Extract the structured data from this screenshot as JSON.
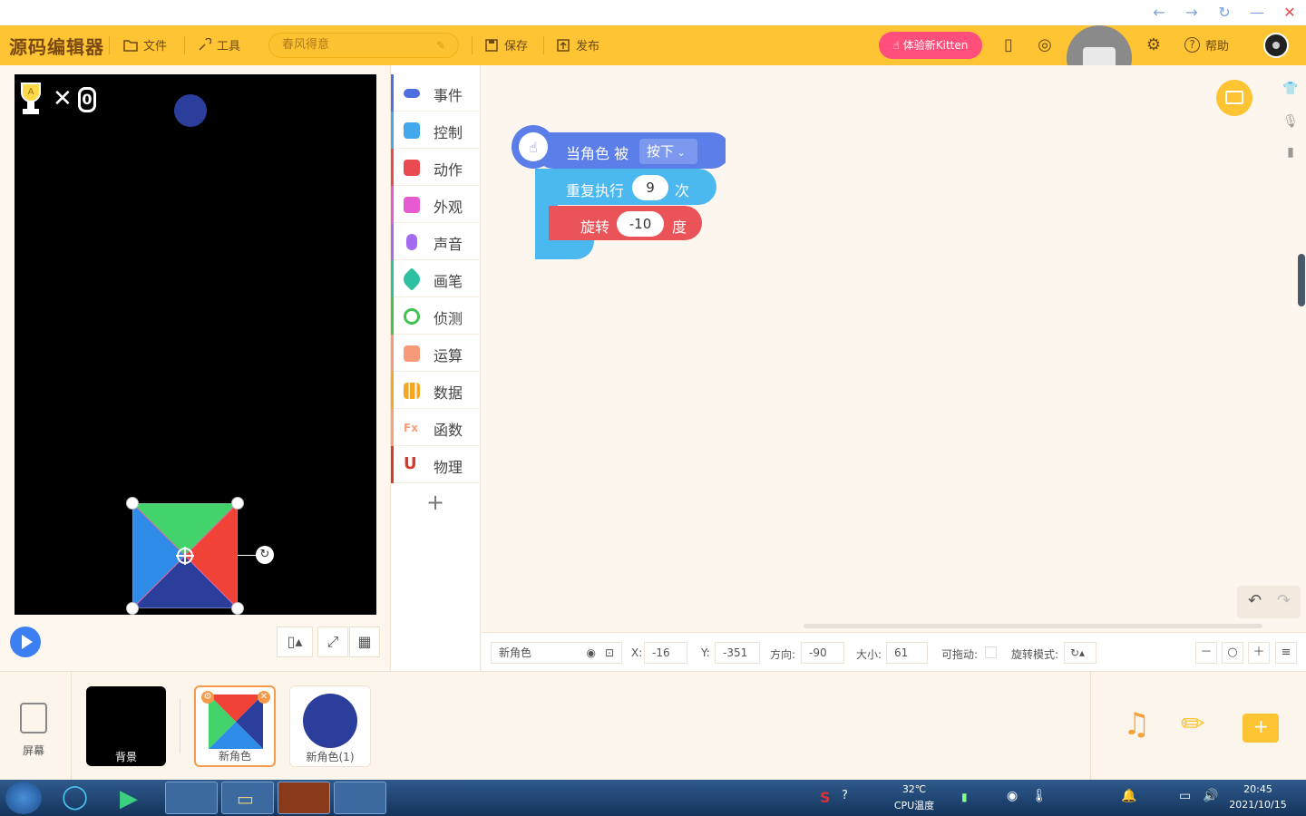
{
  "toolbar": {
    "logo": "源码编辑器",
    "file": "文件",
    "tools": "工具",
    "project_name": "春风得意",
    "save": "保存",
    "publish": "发布",
    "kitten_button": "体验新Kitten",
    "help": "帮助"
  },
  "stage": {
    "score_times": "✕",
    "score_value": "0"
  },
  "categories": [
    {
      "label": "事件",
      "color": "#4d6fe0"
    },
    {
      "label": "控制",
      "color": "#44a8ec"
    },
    {
      "label": "动作",
      "color": "#e84a50"
    },
    {
      "label": "外观",
      "color": "#e65ad2"
    },
    {
      "label": "声音",
      "color": "#a46bf0"
    },
    {
      "label": "画笔",
      "color": "#2cc0a0"
    },
    {
      "label": "侦测",
      "color": "#44c250"
    },
    {
      "label": "运算",
      "color": "#f79a7a"
    },
    {
      "label": "数据",
      "color": "#f5a623"
    },
    {
      "label": "函数",
      "color": "#f7a07a"
    },
    {
      "label": "物理",
      "color": "#d83a2c"
    }
  ],
  "blocks": {
    "event_prefix": "当角色 被",
    "event_option": "按下",
    "repeat_prefix": "重复执行",
    "repeat_count": "9",
    "repeat_suffix": "次",
    "rotate_prefix": "旋转",
    "rotate_value": "-10",
    "rotate_suffix": "度"
  },
  "status": {
    "sprite_name": "新角色",
    "x_label": "X:",
    "x_value": "-16",
    "y_label": "Y:",
    "y_value": "-351",
    "direction_label": "方向:",
    "direction_value": "-90",
    "size_label": "大小:",
    "size_value": "61",
    "draggable_label": "可拖动:",
    "rotation_mode_label": "旋转模式:"
  },
  "sprites": {
    "screen_label": "屏幕",
    "items": [
      {
        "label": "背景"
      },
      {
        "label": "新角色"
      },
      {
        "label": "新角色(1)"
      }
    ]
  },
  "taskbar": {
    "temperature": "32℃",
    "cpu_label": "CPU温度",
    "time": "20:45",
    "date": "2021/10/15"
  }
}
